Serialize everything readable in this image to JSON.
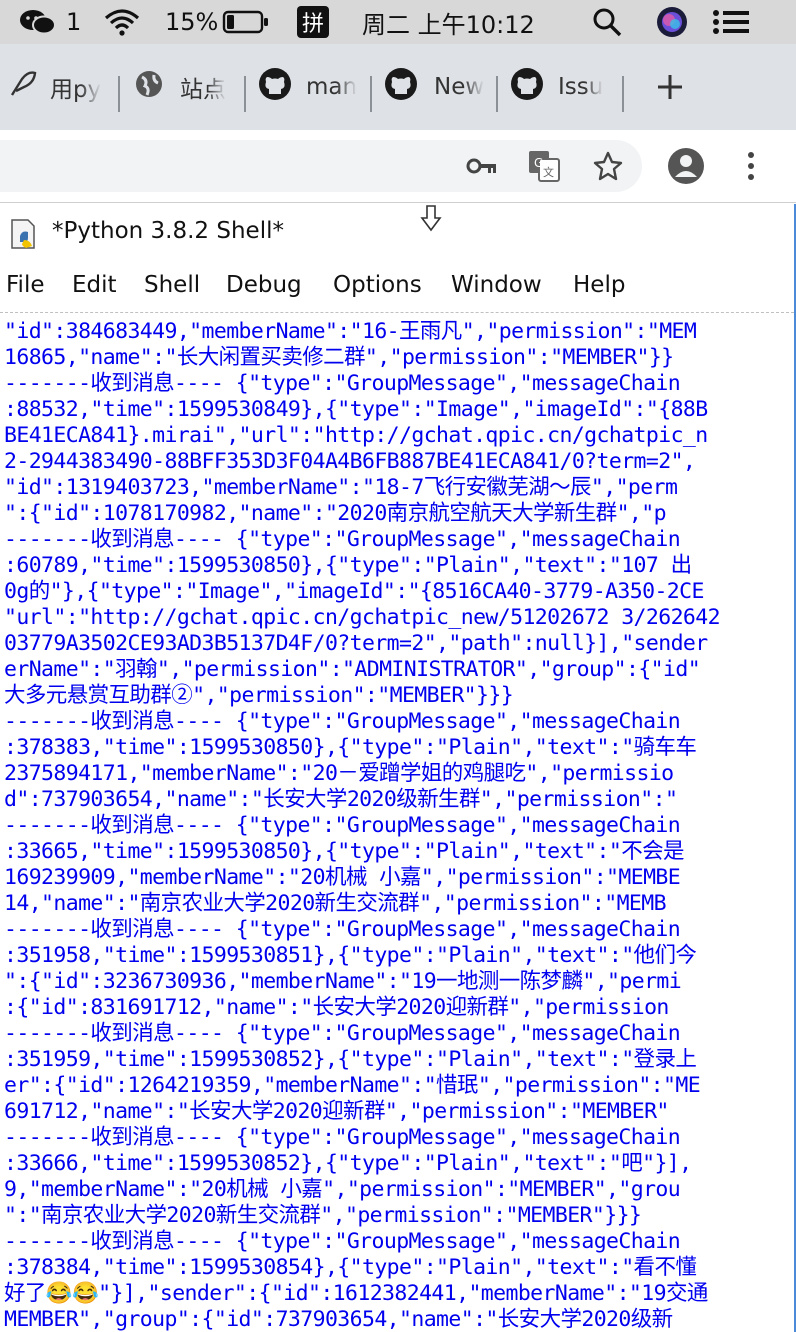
{
  "menubar": {
    "wechat_count": "1",
    "battery_text": "15%",
    "ime_label": "拼",
    "datetime": "周二 上午10:12"
  },
  "tabs": [
    {
      "label": "用py"
    },
    {
      "label": "站点"
    },
    {
      "label": "man"
    },
    {
      "label": "New"
    },
    {
      "label": "Issu"
    }
  ],
  "window": {
    "title": "*Python 3.8.2 Shell*",
    "menu": [
      "File",
      "Edit",
      "Shell",
      "Debug",
      "Options",
      "Window",
      "Help"
    ]
  },
  "shell": {
    "lines": [
      "\"id\":384683449,\"memberName\":\"16-王雨凡\",\"permission\":\"MEM",
      "16865,\"name\":\"长大闲置买卖修二群\",\"permission\":\"MEMBER\"}}",
      "-------收到消息---- {\"type\":\"GroupMessage\",\"messageChain",
      ":88532,\"time\":1599530849},{\"type\":\"Image\",\"imageId\":\"{88B",
      "BE41ECA841}.mirai\",\"url\":\"http://gchat.qpic.cn/gchatpic_n",
      "2-2944383490-88BFF353D3F04A4B6FB887BE41ECA841/0?term=2\",",
      "\"id\":1319403723,\"memberName\":\"18-7飞行安徽芜湖～辰\",\"perm",
      "\":{\"id\":1078170982,\"name\":\"2020南京航空航天大学新生群\",\"p",
      "-------收到消息---- {\"type\":\"GroupMessage\",\"messageChain",
      ":60789,\"time\":1599530850},{\"type\":\"Plain\",\"text\":\"107 出",
      "0g的\"},{\"type\":\"Image\",\"imageId\":\"{8516CA40-3779-A350-2CE",
      "\"url\":\"http://gchat.qpic.cn/gchatpic_new/51202672 3/262642",
      "03779A3502CE93AD3B5137D4F/0?term=2\",\"path\":null}],\"sender",
      "erName\":\"羽翰\",\"permission\":\"ADMINISTRATOR\",\"group\":{\"id\"",
      "大多元悬赏互助群②\",\"permission\":\"MEMBER\"}}}",
      "-------收到消息---- {\"type\":\"GroupMessage\",\"messageChain",
      ":378383,\"time\":1599530850},{\"type\":\"Plain\",\"text\":\"骑车车",
      "2375894171,\"memberName\":\"20－爱蹭学姐的鸡腿吃\",\"permissio",
      "d\":737903654,\"name\":\"长安大学2020级新生群\",\"permission\":\"",
      "-------收到消息---- {\"type\":\"GroupMessage\",\"messageChain",
      ":33665,\"time\":1599530850},{\"type\":\"Plain\",\"text\":\"不会是",
      "169239909,\"memberName\":\"20机械 小嘉\",\"permission\":\"MEMBE",
      "14,\"name\":\"南京农业大学2020新生交流群\",\"permission\":\"MEMB",
      "-------收到消息---- {\"type\":\"GroupMessage\",\"messageChain",
      ":351958,\"time\":1599530851},{\"type\":\"Plain\",\"text\":\"他们今",
      "\":{\"id\":3236730936,\"memberName\":\"19一地测一陈梦麟\",\"permi",
      ":{\"id\":831691712,\"name\":\"长安大学2020迎新群\",\"permission",
      "-------收到消息---- {\"type\":\"GroupMessage\",\"messageChain",
      ":351959,\"time\":1599530852},{\"type\":\"Plain\",\"text\":\"登录上",
      "er\":{\"id\":1264219359,\"memberName\":\"惜珉\",\"permission\":\"ME",
      "691712,\"name\":\"长安大学2020迎新群\",\"permission\":\"MEMBER\"",
      "-------收到消息---- {\"type\":\"GroupMessage\",\"messageChain",
      ":33666,\"time\":1599530852},{\"type\":\"Plain\",\"text\":\"吧\"}],",
      "9,\"memberName\":\"20机械 小嘉\",\"permission\":\"MEMBER\",\"grou",
      "\":\"南京农业大学2020新生交流群\",\"permission\":\"MEMBER\"}}}",
      "-------收到消息---- {\"type\":\"GroupMessage\",\"messageChain",
      ":378384,\"time\":1599530854},{\"type\":\"Plain\",\"text\":\"看不懂",
      "好了😂😂\"}],\"sender\":{\"id\":1612382441,\"memberName\":\"19交通",
      "MEMBER\",\"group\":{\"id\":737903654,\"name\":\"长安大学2020级新"
    ]
  }
}
